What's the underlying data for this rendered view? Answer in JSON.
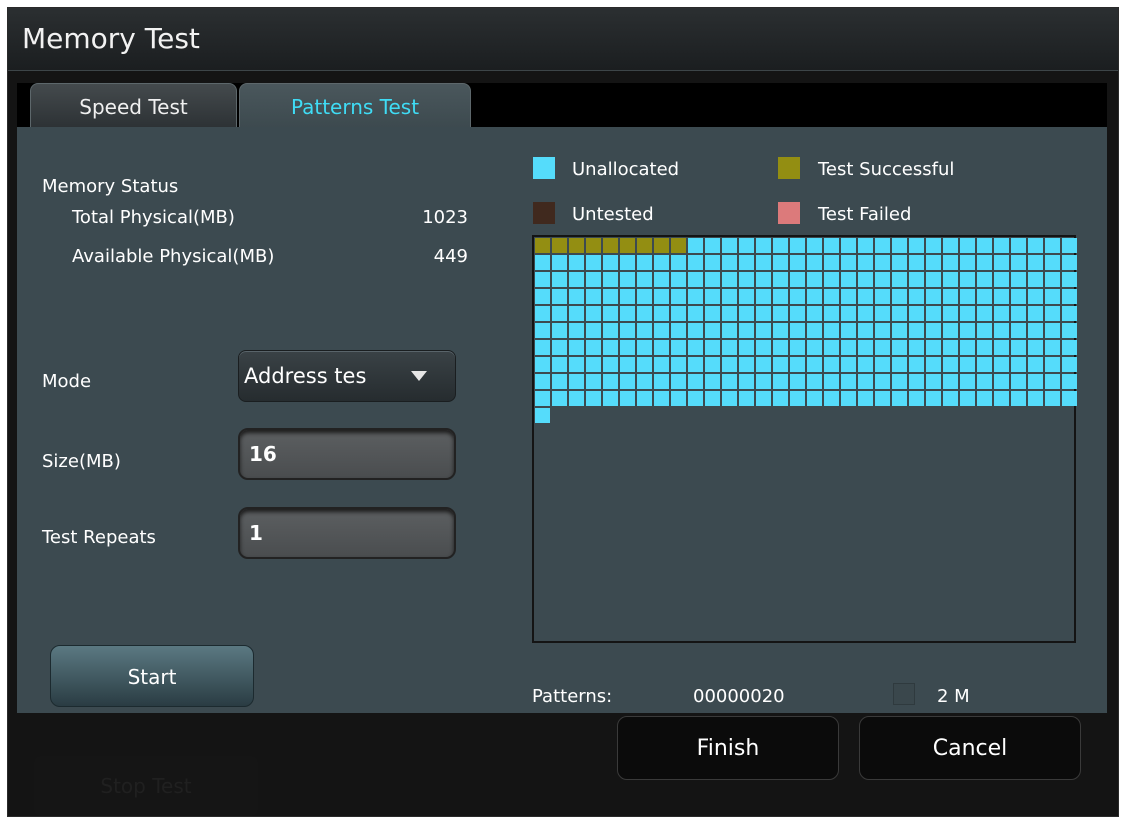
{
  "window": {
    "title": "Memory Test"
  },
  "tabs": [
    {
      "label": "Speed Test",
      "active": false
    },
    {
      "label": "Patterns Test",
      "active": true
    }
  ],
  "memory_status": {
    "heading": "Memory Status",
    "total_label": "Total Physical(MB)",
    "total_value": "1023",
    "available_label": "Available Physical(MB)",
    "available_value": "449"
  },
  "settings": {
    "mode_label": "Mode",
    "mode_value": "Address tes",
    "size_label": "Size(MB)",
    "size_value": "16",
    "repeats_label": "Test Repeats",
    "repeats_value": "1"
  },
  "start_label": "Start",
  "legend": [
    {
      "label": "Unallocated",
      "color": "#55dcfb"
    },
    {
      "label": "Test Successful",
      "color": "#938e12"
    },
    {
      "label": "Untested",
      "color": "#40291e"
    },
    {
      "label": "Test Failed",
      "color": "#dc7a7b"
    }
  ],
  "block_grid": {
    "columns": 32,
    "successful_blocks": 9,
    "unallocated_blocks": 312,
    "colors": {
      "unallocated": "#55dcfb",
      "successful": "#938e12"
    }
  },
  "patterns": {
    "label": "Patterns:",
    "value": "00000020",
    "block_size_label": "2 M"
  },
  "bottom": {
    "hidden_button_label": "Stop Test",
    "finish_label": "Finish",
    "cancel_label": "Cancel"
  }
}
